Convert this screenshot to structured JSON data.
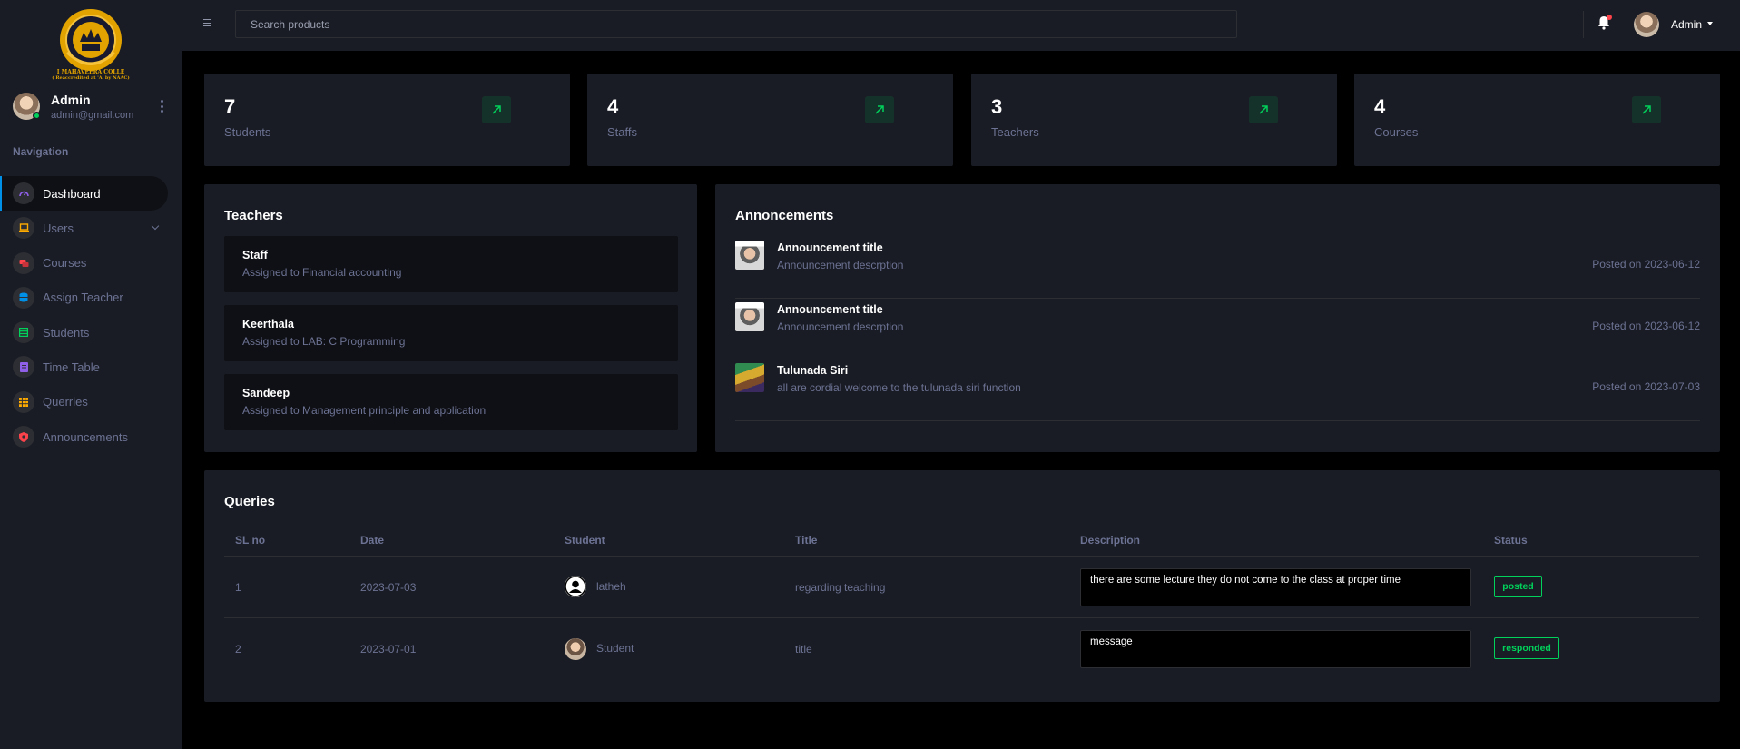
{
  "colors": {
    "bg": "#000000",
    "panel": "#191c24",
    "inner": "#0f1015",
    "text_muted": "#6c7293",
    "success": "#00d25b",
    "primary": "#0090e7",
    "danger": "#fc424a"
  },
  "sidebar": {
    "logo_text": "I MAHAVEERA COLLE",
    "logo_subtext": "( Reaccredited at 'A' by NAAC)",
    "profile": {
      "name": "Admin",
      "email": "admin@gmail.com"
    },
    "nav_category": "Navigation",
    "items": [
      {
        "label": "Dashboard",
        "icon": "speedometer-icon",
        "color": "#8f5fe8"
      },
      {
        "label": "Users",
        "icon": "laptop-icon",
        "color": "#ffab00"
      },
      {
        "label": "Courses",
        "icon": "chat-icon",
        "color": "#fc424a"
      },
      {
        "label": "Assign Teacher",
        "icon": "database-icon",
        "color": "#0090e7"
      },
      {
        "label": "Students",
        "icon": "table-icon",
        "color": "#00d25b"
      },
      {
        "label": "Time Table",
        "icon": "document-icon",
        "color": "#8f5fe8"
      },
      {
        "label": "Querries",
        "icon": "grid-icon",
        "color": "#ffab00"
      },
      {
        "label": "Announcements",
        "icon": "security-icon",
        "color": "#fc424a"
      }
    ]
  },
  "topbar": {
    "search_placeholder": "Search products",
    "user_name": "Admin",
    "icons": [
      "menu-icon",
      "bell-icon"
    ]
  },
  "stats": [
    {
      "value": "7",
      "label": "Students",
      "icon": "arrow-top-right-icon"
    },
    {
      "value": "4",
      "label": "Staffs",
      "icon": "arrow-top-right-icon"
    },
    {
      "value": "3",
      "label": "Teachers",
      "icon": "arrow-top-right-icon"
    },
    {
      "value": "4",
      "label": "Courses",
      "icon": "arrow-top-right-icon"
    }
  ],
  "teachers": {
    "title": "Teachers",
    "items": [
      {
        "name": "Staff",
        "assignment": "Assigned to Financial accounting"
      },
      {
        "name": "Keerthala",
        "assignment": "Assigned to LAB: C Programming"
      },
      {
        "name": "Sandeep",
        "assignment": "Assigned to Management principle and application"
      }
    ]
  },
  "announcements": {
    "title": "Annoncements",
    "items": [
      {
        "title": "Announcement title",
        "description": "Announcement descrption",
        "date": "Posted on 2023-06-12"
      },
      {
        "title": "Announcement title",
        "description": "Announcement descrption",
        "date": "Posted on 2023-06-12"
      },
      {
        "title": "Tulunada Siri",
        "description": "all are cordial welcome to the tulunada siri function",
        "date": "Posted on 2023-07-03"
      }
    ]
  },
  "queries": {
    "title": "Queries",
    "columns": [
      "SL no",
      "Date",
      "Student",
      "Title",
      "Description",
      "Status"
    ],
    "rows": [
      {
        "sl": "1",
        "date": "2023-07-03",
        "student": "latheh",
        "title": "regarding teaching",
        "description": "there are some lecture they do not come to the class at proper time",
        "status": "posted"
      },
      {
        "sl": "2",
        "date": "2023-07-01",
        "student": "Student",
        "title": "title",
        "description": "message",
        "status": "responded"
      }
    ]
  }
}
